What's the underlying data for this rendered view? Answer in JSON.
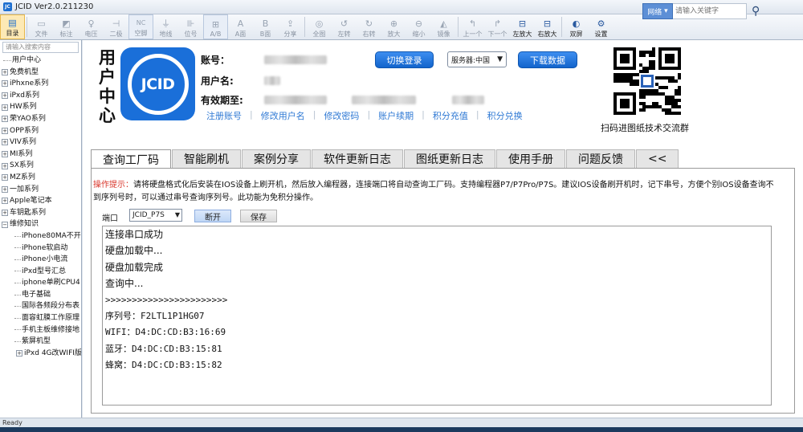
{
  "window": {
    "title": "JCID Ver2.0.211230"
  },
  "toolbar": {
    "buttons": [
      {
        "label": "目录",
        "icon": "folder-icon",
        "state": "active"
      },
      {
        "label": "文件",
        "icon": "file-icon",
        "state": "disabled"
      },
      {
        "label": "标注",
        "icon": "tag-icon",
        "state": "disabled"
      },
      {
        "label": "电压",
        "icon": "voltage-icon",
        "state": "disabled"
      },
      {
        "label": "二极",
        "icon": "diode-icon",
        "state": "disabled"
      },
      {
        "label": "空脚",
        "icon": "nc-icon",
        "state": "disabled"
      },
      {
        "label": "地线",
        "icon": "ground-icon",
        "state": "disabled"
      },
      {
        "label": "位号",
        "icon": "position-icon",
        "state": "disabled"
      },
      {
        "label": "A/B",
        "icon": "ab-icon",
        "state": "disabled"
      },
      {
        "label": "A面",
        "icon": "side-a-icon",
        "state": "disabled"
      },
      {
        "label": "B面",
        "icon": "side-b-icon",
        "state": "disabled"
      },
      {
        "label": "分享",
        "icon": "share-icon",
        "state": "disabled"
      },
      {
        "label": "全图",
        "icon": "fullmap-icon",
        "state": "disabled"
      },
      {
        "label": "左转",
        "icon": "rotate-left-icon",
        "state": "disabled"
      },
      {
        "label": "右转",
        "icon": "rotate-right-icon",
        "state": "disabled"
      },
      {
        "label": "放大",
        "icon": "zoom-in-icon",
        "state": "disabled"
      },
      {
        "label": "缩小",
        "icon": "zoom-out-icon",
        "state": "disabled"
      },
      {
        "label": "镜像",
        "icon": "mirror-icon",
        "state": "disabled"
      },
      {
        "label": "上一个",
        "icon": "prev-icon",
        "state": "disabled"
      },
      {
        "label": "下一个",
        "icon": "next-icon",
        "state": "disabled"
      },
      {
        "label": "左放大",
        "icon": "left-zoom-icon",
        "state": "enabled"
      },
      {
        "label": "右放大",
        "icon": "right-zoom-icon",
        "state": "enabled"
      },
      {
        "label": "双屏",
        "icon": "dual-screen-icon",
        "state": "enabled"
      },
      {
        "label": "设置",
        "icon": "gear-icon",
        "state": "enabled"
      }
    ],
    "search_scope": "网络",
    "search_placeholder": "请输入关键字"
  },
  "sidebar": {
    "search_placeholder": "请输入搜索内容",
    "items": [
      {
        "label": "用户中心",
        "type": "leaf"
      },
      {
        "label": "免费机型",
        "type": "group"
      },
      {
        "label": "iPhxne系列",
        "type": "group"
      },
      {
        "label": "iPxd系列",
        "type": "group"
      },
      {
        "label": "HW系列",
        "type": "group"
      },
      {
        "label": "荣YAO系列",
        "type": "group"
      },
      {
        "label": "OPP系列",
        "type": "group"
      },
      {
        "label": "VIV系列",
        "type": "group"
      },
      {
        "label": "MI系列",
        "type": "group"
      },
      {
        "label": "SX系列",
        "type": "group"
      },
      {
        "label": "MZ系列",
        "type": "group"
      },
      {
        "label": "一加系列",
        "type": "group"
      },
      {
        "label": "Apple笔记本",
        "type": "group"
      },
      {
        "label": "车钥匙系列",
        "type": "group"
      },
      {
        "label": "维修知识",
        "type": "open"
      },
      {
        "label": "iPhone80MA不开",
        "type": "child"
      },
      {
        "label": "iPhone软启动",
        "type": "child"
      },
      {
        "label": "iPhone小电流",
        "type": "child"
      },
      {
        "label": "iPxd型号汇总",
        "type": "child"
      },
      {
        "label": "iphone单刷CPU4",
        "type": "child"
      },
      {
        "label": "电子基础",
        "type": "child"
      },
      {
        "label": "国际各频段分布表",
        "type": "child"
      },
      {
        "label": "面容虹膜工作原理",
        "type": "child"
      },
      {
        "label": "手机主板维修接地",
        "type": "child"
      },
      {
        "label": "紫屏机型",
        "type": "child"
      },
      {
        "label": "iPxd 4G改WIFI版",
        "type": "child-group"
      }
    ]
  },
  "user_center": {
    "title_chars": [
      "用",
      "户",
      "中",
      "心"
    ],
    "logo_text": "JCID",
    "account_label": "账号：",
    "username_label": "用户名:",
    "expiry_label": "有效期至:",
    "switch_login": "切换登录",
    "server": "服务器:中国",
    "download": "下载数据",
    "links": [
      "注册账号",
      "修改用户名",
      "修改密码",
      "账户续期",
      "积分充值",
      "积分兑换"
    ],
    "qr_caption": "扫码进图纸技术交流群"
  },
  "tabs": [
    "查询工厂码",
    "智能刷机",
    "案例分享",
    "软件更新日志",
    "图纸更新日志",
    "使用手册",
    "问题反馈",
    "<<"
  ],
  "active_tab": 0,
  "query_panel": {
    "tip_label": "操作提示：",
    "tip_text": "请将硬盘格式化后安装在IOS设备上刷开机，然后放入编程器，连接端口将自动查询工厂码。支持编程器P7/P7Pro/P7S。建议IOS设备刷开机时，记下串号，方便个别IOS设备查询不到序列号时，可以通过串号查询序列号。此功能为免积分操作。",
    "port_label": "端口",
    "port_value": "JCID_P7S",
    "disconnect": "断开",
    "save": "保存",
    "log": [
      "连接串口成功",
      "硬盘加载中...",
      "硬盘加载完成",
      "查询中...",
      ">>>>>>>>>>>>>>>>>>>>>>>",
      "序列号：F2LTL1P1HG07",
      "WIFI：D4:DC:CD:B3:16:69",
      "蓝牙：D4:DC:CD:B3:15:81",
      "蜂窝：D4:DC:CD:B3:15:82"
    ]
  },
  "status": {
    "text": "Ready"
  },
  "colors": {
    "accent": "#1a6fd9",
    "link": "#2f79d4",
    "tip": "#d9362b",
    "active_toolbar": "#fde9b5"
  }
}
